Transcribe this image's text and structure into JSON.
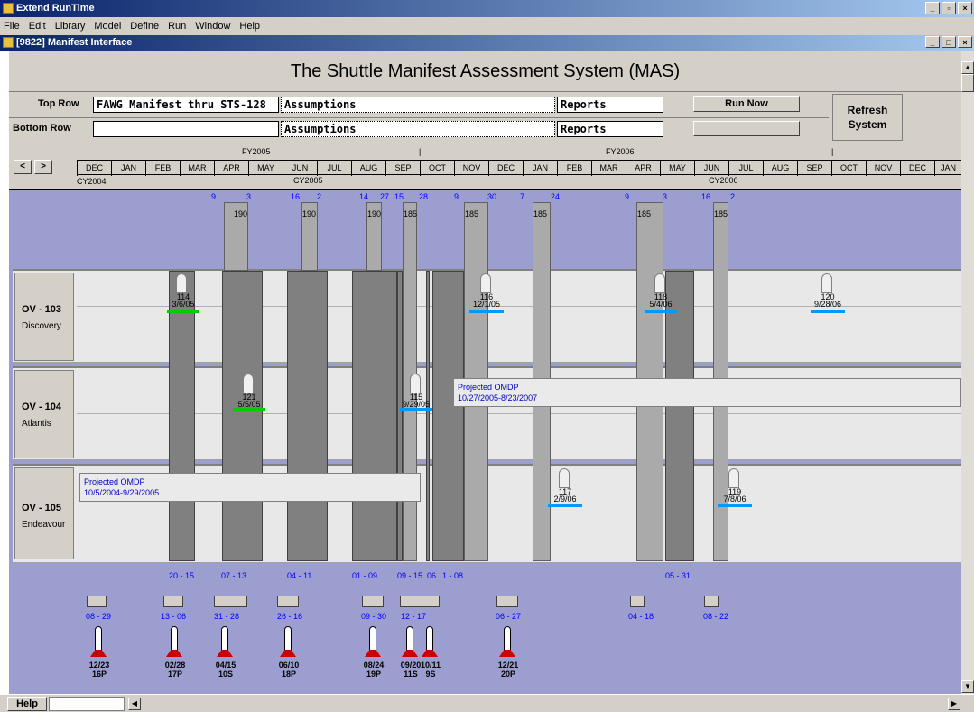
{
  "app": {
    "title": "Extend RunTime",
    "menus": [
      "File",
      "Edit",
      "Library",
      "Model",
      "Define",
      "Run",
      "Window",
      "Help"
    ]
  },
  "child": {
    "title": "[9822]  Manifest Interface"
  },
  "main_title": "The Shuttle Manifest Assessment System (MAS)",
  "top_row": {
    "label": "Top Row",
    "manifest": "FAWG Manifest thru STS-128",
    "assumptions": "Assumptions",
    "reports": "Reports",
    "run_now": "Run Now"
  },
  "bottom_row": {
    "label": "Bottom Row",
    "manifest": "",
    "assumptions": "Assumptions",
    "reports": "Reports",
    "run_now": ""
  },
  "refresh": "Refresh\nSystem",
  "nav": {
    "prev": "<",
    "next": ">"
  },
  "fiscal_years": [
    "FY2005",
    "FY2006"
  ],
  "calendar_years": [
    "CY2004",
    "CY2005",
    "CY2006"
  ],
  "months": [
    "DEC",
    "JAN",
    "FEB",
    "MAR",
    "APR",
    "MAY",
    "JUN",
    "JUL",
    "AUG",
    "SEP",
    "OCT",
    "NOV",
    "DEC",
    "JAN",
    "FEB",
    "MAR",
    "APR",
    "MAY",
    "JUN",
    "JUL",
    "AUG",
    "SEP",
    "OCT",
    "NOV",
    "DEC",
    "JAN"
  ],
  "orbiters": [
    {
      "name": "OV - 103",
      "sub": "Discovery"
    },
    {
      "name": "OV - 104",
      "sub": "Atlantis"
    },
    {
      "name": "OV - 105",
      "sub": "Endeavour"
    }
  ],
  "top_numbers": [
    {
      "t": "9"
    },
    {
      "t": "3"
    },
    {
      "t": "16"
    },
    {
      "t": "2"
    },
    {
      "t": "14"
    },
    {
      "t": "27"
    },
    {
      "t": "15"
    },
    {
      "t": "28"
    },
    {
      "t": "9"
    },
    {
      "t": "30"
    },
    {
      "t": "7"
    },
    {
      "t": "24"
    },
    {
      "t": "9"
    },
    {
      "t": "3"
    },
    {
      "t": "16"
    },
    {
      "t": "2"
    }
  ],
  "durations": [
    "190",
    "190",
    "190",
    "185",
    "185",
    "185",
    "185",
    "185"
  ],
  "missions": [
    {
      "num": "114",
      "date": "3/6/05",
      "color": "green"
    },
    {
      "num": "116",
      "date": "12/1/05",
      "color": "blue"
    },
    {
      "num": "118",
      "date": "5/4/06",
      "color": "blue"
    },
    {
      "num": "120",
      "date": "9/28/06",
      "color": "blue"
    },
    {
      "num": "121",
      "date": "5/5/05",
      "color": "green"
    },
    {
      "num": "115",
      "date": "9/29/05",
      "color": "blue"
    },
    {
      "num": "117",
      "date": "2/9/06",
      "color": "blue"
    },
    {
      "num": "119",
      "date": "7/8/06",
      "color": "blue"
    }
  ],
  "omdp": [
    {
      "title": "Projected OMDP",
      "range": "10/27/2005-8/23/2007"
    },
    {
      "title": "Projected OMDP",
      "range": "10/5/2004-9/29/2005"
    }
  ],
  "bottom_ranges": [
    "20 - 15",
    "07 - 13",
    "04 - 11",
    "01 - 09",
    "09 - 15",
    "06",
    "1 - 08",
    "05 - 31"
  ],
  "small_ranges": [
    "08 - 29",
    "13 - 06",
    "31 - 28",
    "26 - 16",
    "09 - 30",
    "12 - 17",
    "06 - 27",
    "04 - 18",
    "08 - 22"
  ],
  "rockets": [
    {
      "date": "12/23",
      "id": "16P"
    },
    {
      "date": "02/28",
      "id": "17P"
    },
    {
      "date": "04/15",
      "id": "10S"
    },
    {
      "date": "06/10",
      "id": "18P"
    },
    {
      "date": "08/24",
      "id": "19P"
    },
    {
      "date": "09/20",
      "id": "11S"
    },
    {
      "date": "10/11",
      "id": "9S"
    },
    {
      "date": "12/21",
      "id": "20P"
    }
  ],
  "status": {
    "help": "Help"
  }
}
